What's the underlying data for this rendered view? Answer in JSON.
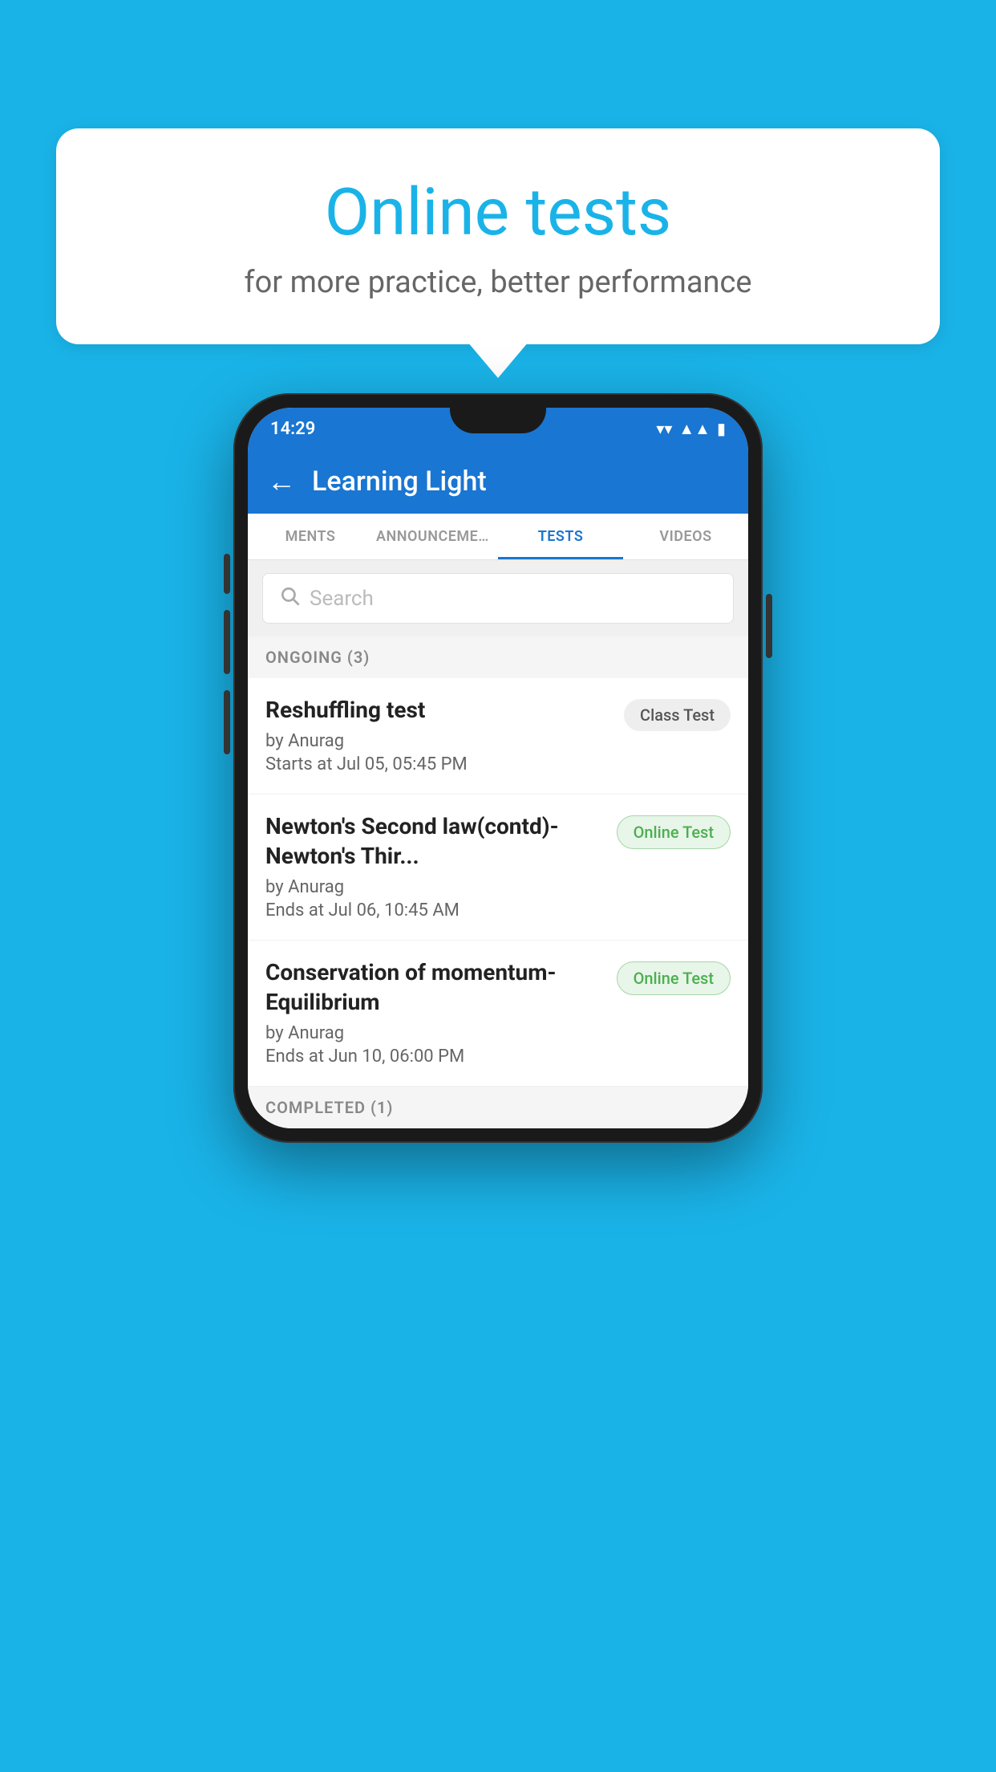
{
  "background_color": "#1ab3e8",
  "bubble": {
    "title": "Online tests",
    "subtitle": "for more practice, better performance"
  },
  "phone": {
    "status_bar": {
      "time": "14:29",
      "wifi": "▾",
      "signal": "▲",
      "battery": "▮"
    },
    "app_bar": {
      "back_label": "←",
      "title": "Learning Light"
    },
    "tabs": [
      {
        "label": "MENTS",
        "active": false
      },
      {
        "label": "ANNOUNCEMENTS",
        "active": false
      },
      {
        "label": "TESTS",
        "active": true
      },
      {
        "label": "VIDEOS",
        "active": false
      }
    ],
    "search": {
      "placeholder": "Search"
    },
    "ongoing_section": {
      "label": "ONGOING (3)"
    },
    "tests": [
      {
        "name": "Reshuffling test",
        "author": "by Anurag",
        "date": "Starts at  Jul 05, 05:45 PM",
        "badge": "Class Test",
        "badge_type": "class"
      },
      {
        "name": "Newton's Second law(contd)-Newton's Thir...",
        "author": "by Anurag",
        "date": "Ends at  Jul 06, 10:45 AM",
        "badge": "Online Test",
        "badge_type": "online"
      },
      {
        "name": "Conservation of momentum-Equilibrium",
        "author": "by Anurag",
        "date": "Ends at  Jun 10, 06:00 PM",
        "badge": "Online Test",
        "badge_type": "online"
      }
    ],
    "completed_section": {
      "label": "COMPLETED (1)"
    }
  }
}
